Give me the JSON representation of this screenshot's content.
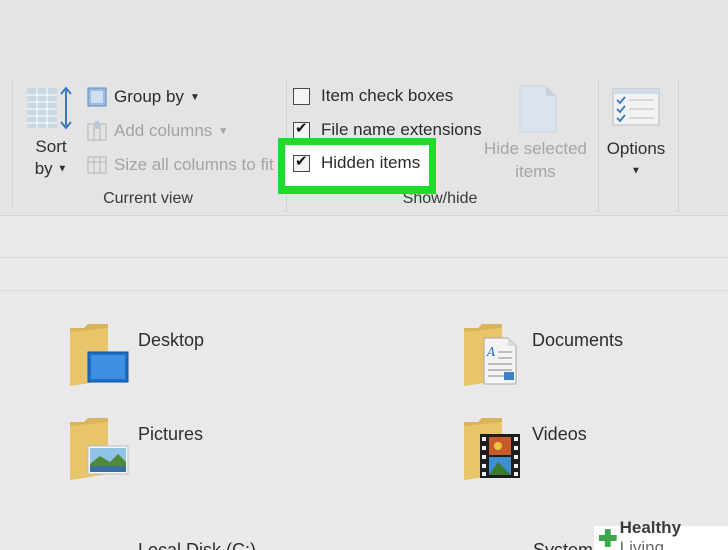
{
  "ribbon": {
    "current_view": {
      "group_label": "Current view",
      "sort_label": "Sort",
      "sort_label_2": "by",
      "group_by_label": "Group by",
      "add_columns_label": "Add columns",
      "size_columns_label": "Size all columns to fit"
    },
    "show_hide": {
      "group_label": "Show/hide",
      "item_check_boxes": {
        "label": "Item check boxes",
        "checked": false
      },
      "file_name_extensions": {
        "label": "File name extensions",
        "checked": true
      },
      "hidden_items": {
        "label": "Hidden items",
        "checked": true
      },
      "hide_selected_label_1": "Hide selected",
      "hide_selected_label_2": "items"
    },
    "options_label": "Options"
  },
  "folders": [
    {
      "name": "Desktop",
      "icon": "desktop-folder-icon"
    },
    {
      "name": "Documents",
      "icon": "documents-folder-icon"
    },
    {
      "name": "Pictures",
      "icon": "pictures-folder-icon"
    },
    {
      "name": "Videos",
      "icon": "videos-folder-icon"
    }
  ],
  "drives_partial": {
    "left": "Local Disk (C:)",
    "right": "System"
  },
  "watermark": {
    "brand_bold": "Healthy",
    "brand_light": " Living"
  },
  "colors": {
    "highlight": "#1cdc2c",
    "folder": "#e8c46a",
    "accent_blue": "#2f78c8"
  }
}
